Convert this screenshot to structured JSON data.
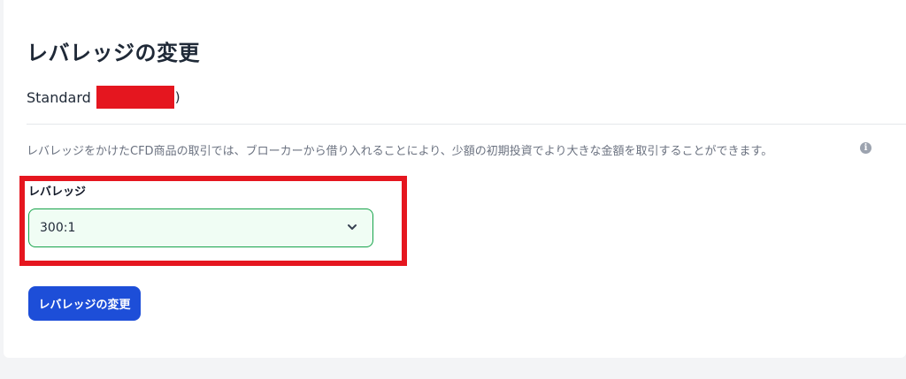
{
  "page": {
    "title": "レバレッジの変更"
  },
  "account": {
    "type": "Standard",
    "tail": ")"
  },
  "description": "レバレッジをかけたCFD商品の取引では、ブローカーから借り入れることにより、少額の初期投資でより大きな金額を取引することができます。",
  "form": {
    "leverage_label": "レバレッジ",
    "leverage_value": "300:1",
    "submit_label": "レバレッジの変更"
  },
  "icons": {
    "info": "info-icon",
    "dropdown": "chevron-down-icon"
  },
  "colors": {
    "primary": "#1d4ed8",
    "highlight": "#e5161f",
    "select_border": "#16a34a",
    "select_bg": "#f0fdf4"
  }
}
